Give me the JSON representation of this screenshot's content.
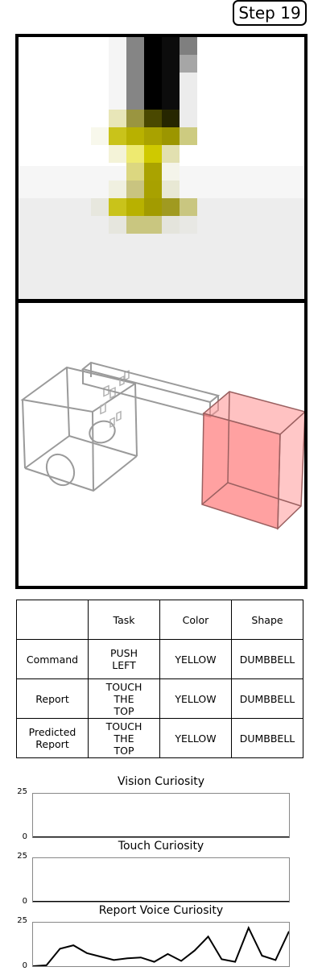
{
  "step": {
    "label": "Step 19"
  },
  "vision": {
    "colors": {
      "black": "#000000",
      "dark_gray": "#7f7f7f",
      "yellow": "#c9c31a",
      "light_yellow": "#eeea70",
      "background": "#ededed"
    }
  },
  "scene": {
    "colors": {
      "wireframe": "#9a9a9a",
      "red_box": "#ff6f6f"
    }
  },
  "table": {
    "headers": [
      "",
      "Task",
      "Color",
      "Shape"
    ],
    "rows": [
      {
        "label": "Command",
        "task": "PUSH\nLEFT",
        "color": "YELLOW",
        "shape": "DUMBBELL"
      },
      {
        "label": "Report",
        "task": "TOUCH\nTHE\nTOP",
        "color": "YELLOW",
        "shape": "DUMBBELL"
      },
      {
        "label": "Predicted\nReport",
        "task": "TOUCH\nTHE\nTOP",
        "color": "YELLOW",
        "shape": "DUMBBELL"
      }
    ]
  },
  "graphs": [
    {
      "title": "Vision Curiosity",
      "ymax": "25",
      "ymin": "0"
    },
    {
      "title": "Touch Curiosity",
      "ymax": "25",
      "ymin": "0"
    },
    {
      "title": "Report Voice Curiosity",
      "ymax": "25",
      "ymin": "0"
    }
  ],
  "chart_data": [
    {
      "type": "line",
      "title": "Vision Curiosity",
      "ylim": [
        0,
        25
      ],
      "series": [
        {
          "values": []
        }
      ]
    },
    {
      "type": "line",
      "title": "Touch Curiosity",
      "ylim": [
        0,
        25
      ],
      "series": [
        {
          "values": []
        }
      ]
    },
    {
      "type": "line",
      "title": "Report Voice Curiosity",
      "ylim": [
        0,
        25
      ],
      "series": [
        {
          "values": [
            0,
            0.5,
            10,
            12,
            7.5,
            5.5,
            3.5,
            4.5,
            5,
            2.5,
            7,
            3,
            9,
            17,
            4,
            2.5,
            22,
            6,
            3.5,
            20
          ]
        }
      ]
    }
  ]
}
